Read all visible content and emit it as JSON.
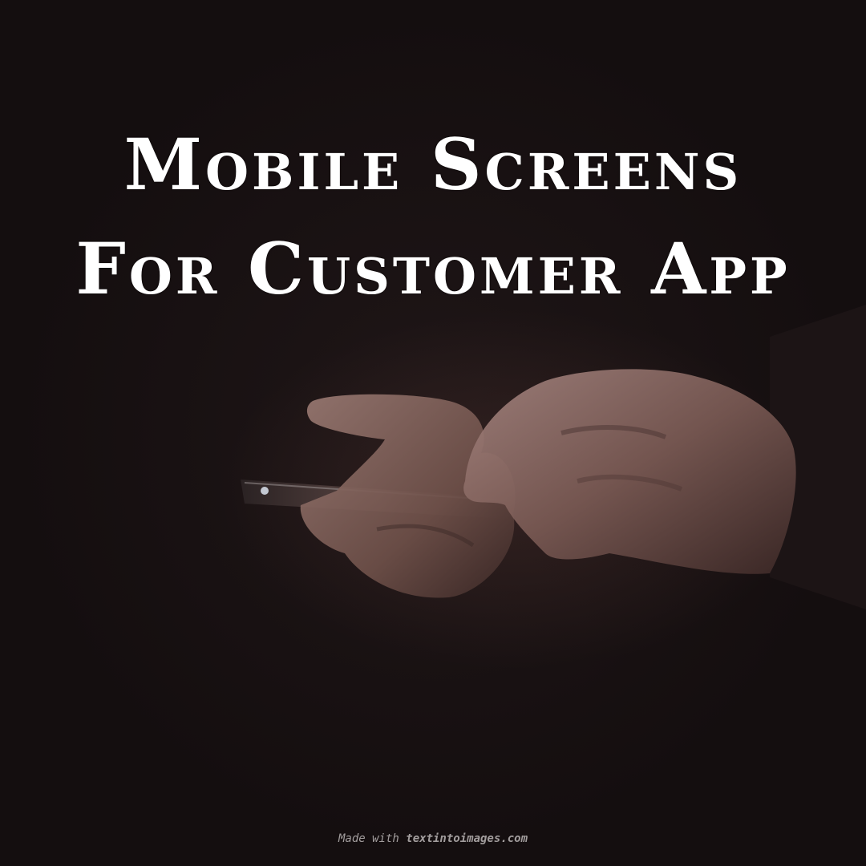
{
  "title": {
    "line1": "Mobile Screens",
    "line2": "For Customer App"
  },
  "watermark": {
    "prefix": "Made with",
    "site": "textintoimages.com"
  },
  "colors": {
    "background": "#1a1213",
    "text": "#ffffff",
    "skin": "#8a6a63"
  }
}
